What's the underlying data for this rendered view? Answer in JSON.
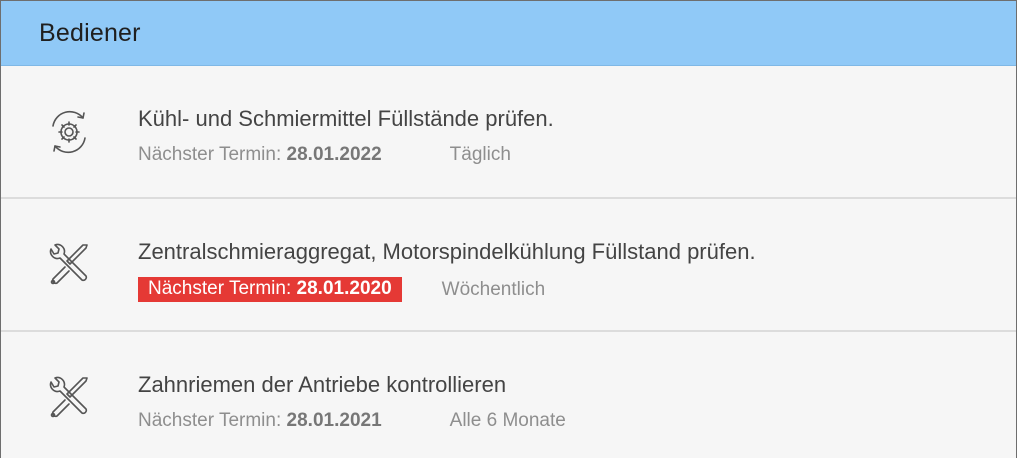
{
  "header": {
    "title": "Bediener"
  },
  "colors": {
    "header_bg": "#90c9f7",
    "overdue": "#e53935"
  },
  "tasks": [
    {
      "icon": "gear-cycle-icon",
      "title": "Kühl- und Schmiermittel Füllstände prüfen.",
      "due_label": "Nächster Termin:",
      "due_date": "28.01.2022",
      "overdue": false,
      "frequency": "Täglich"
    },
    {
      "icon": "tools-icon",
      "title": "Zentralschmieraggregat, Motorspindelkühlung Füllstand prüfen.",
      "due_label": "Nächster Termin:",
      "due_date": "28.01.2020",
      "overdue": true,
      "frequency": "Wöchentlich"
    },
    {
      "icon": "tools-icon",
      "title": "Zahnriemen der Antriebe kontrollieren",
      "due_label": "Nächster Termin:",
      "due_date": "28.01.2021",
      "overdue": false,
      "frequency": "Alle 6 Monate"
    }
  ]
}
